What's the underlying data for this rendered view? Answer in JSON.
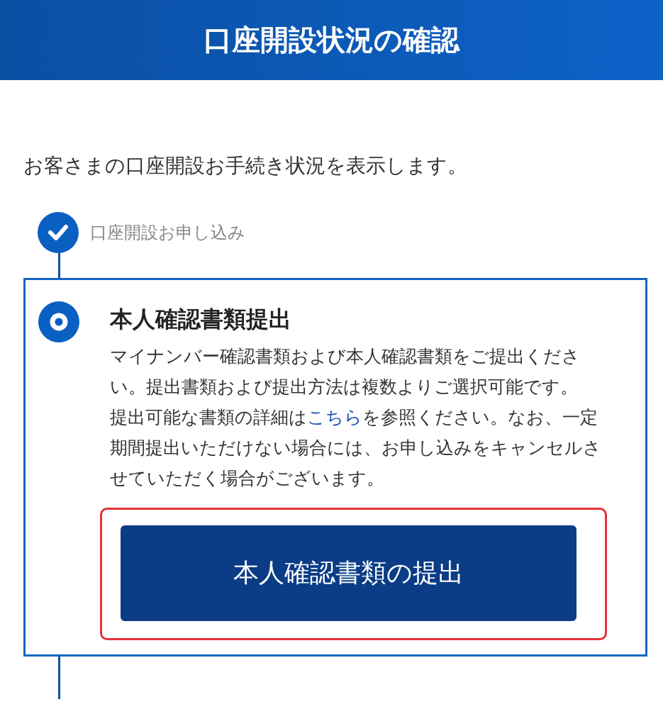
{
  "header": {
    "title": "口座開設状況の確認"
  },
  "intro": "お客さまの口座開設お手続き状況を表示します。",
  "steps": [
    {
      "kind": "done",
      "title": "口座開設お申し込み"
    },
    {
      "kind": "current",
      "title": "本人確認書類提出",
      "description": "マイナンバー確認書類および本人確認書類をご提出ください。提出書類および提出方法は複数よりご選択可能です。",
      "note_before": "提出可能な書類の詳細は",
      "note_link": "こちら",
      "note_after": "を参照ください。なお、一定期間提出いただけない場合には、お申し込みをキャンセルさせていただく場合がございます。",
      "button": "本人確認書類の提出",
      "highlighted": true
    }
  ]
}
